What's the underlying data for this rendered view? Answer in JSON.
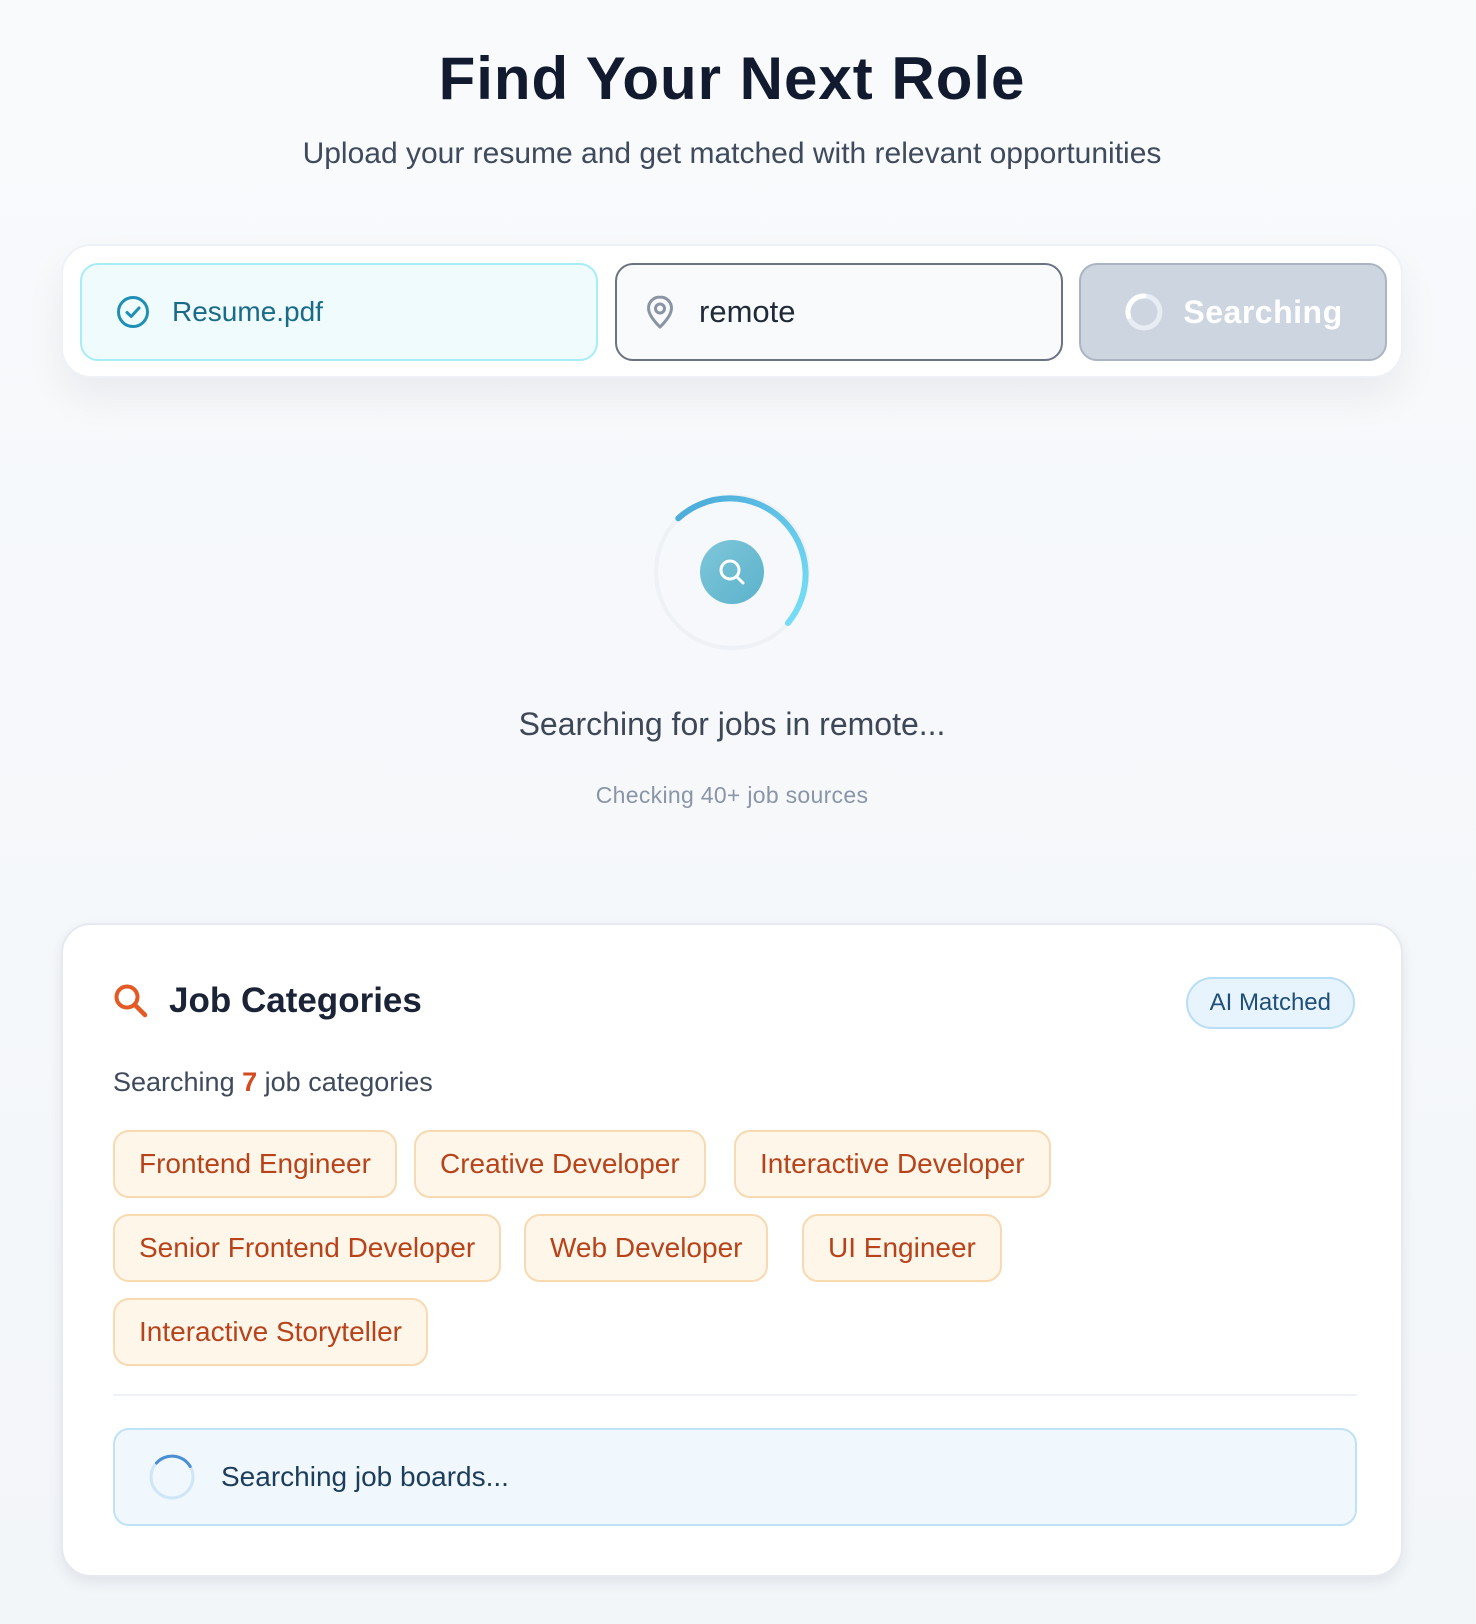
{
  "header": {
    "title": "Find Your Next Role",
    "subtitle": "Upload your resume and get matched with relevant opportunities"
  },
  "search_bar": {
    "resume": {
      "file_name": "Resume.pdf",
      "icon": "check-circle-icon"
    },
    "location": {
      "value": "remote",
      "icon": "map-pin-icon"
    },
    "button": {
      "label": "Searching",
      "state": "loading",
      "icon": "spinner-icon"
    }
  },
  "loader": {
    "icon": "search-icon",
    "message": "Searching for jobs in remote...",
    "sub_message": "Checking 40+ job sources"
  },
  "categories": {
    "icon": "search-icon",
    "title": "Job Categories",
    "badge": "AI Matched",
    "count_prefix": "Searching",
    "count": "7",
    "count_suffix": "job categories",
    "chips": [
      "Frontend Engineer",
      "Creative Developer",
      "Interactive Developer",
      "Senior Frontend Developer",
      "Web Developer",
      "UI Engineer",
      "Interactive Storyteller"
    ],
    "status": "Searching job boards..."
  },
  "colors": {
    "accent_orange": "#d24a1d",
    "accent_cyan": "#4cc9e8",
    "chip_bg": "#fff6ea",
    "status_bg": "#f0f7fd"
  }
}
